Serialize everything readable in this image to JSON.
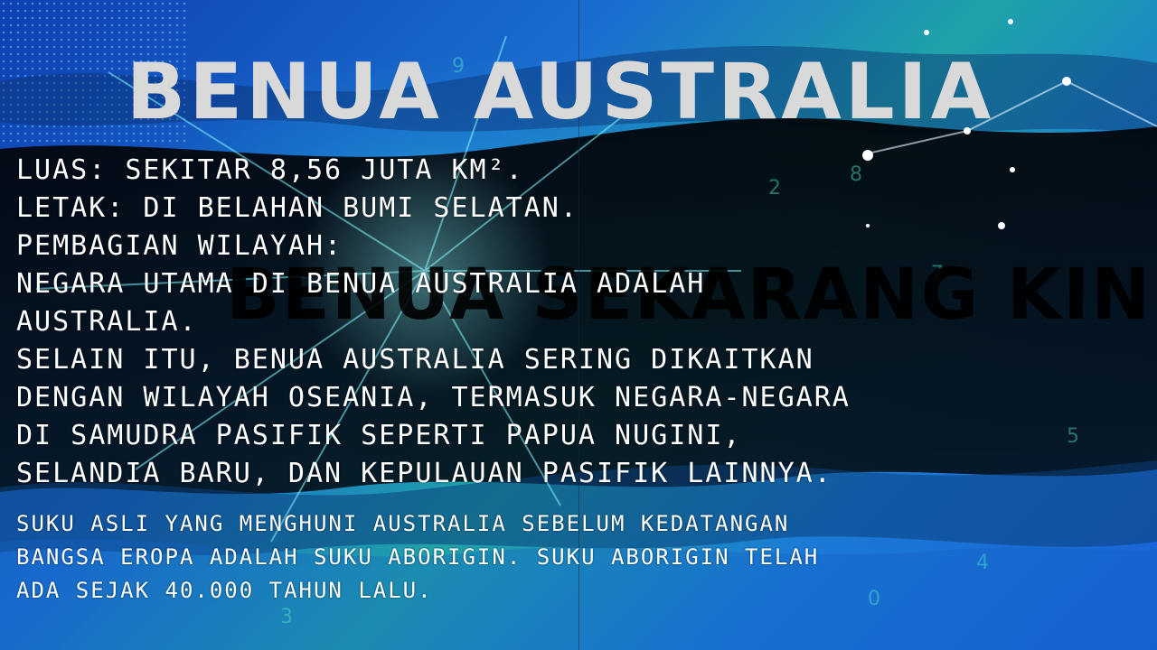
{
  "slide": {
    "title": "BENUA AUSTRALIA",
    "ghost_text": "BENUA SEKARANG KINI",
    "body_lines": [
      "LUAS: SEKITAR 8,56 JUTA KM².",
      "LETAK: DI BELAHAN BUMI SELATAN.",
      "PEMBAGIAN WILAYAH:",
      "NEGARA UTAMA DI BENUA AUSTRALIA ADALAH",
      "AUSTRALIA.",
      "SELAIN ITU, BENUA AUSTRALIA SERING DIKAITKAN",
      "DENGAN WILAYAH OSEANIA, TERMASUK NEGARA-NEGARA",
      "DI SAMUDRA PASIFIK SEPERTI PAPUA NUGINI,",
      "SELANDIA BARU, DAN KEPULAUAN PASIFIK LAINNYA."
    ],
    "note_lines": [
      "SUKU ASLI YANG MENGHUNI AUSTRALIA SEBELUM KEDATANGAN",
      "BANGSA EROPA ADALAH SUKU ABORIGIN. SUKU ABORIGIN TELAH",
      "ADA SEJAK 40.000 TAHUN LALU."
    ]
  },
  "colors": {
    "background_primary": "#1a5fd8",
    "background_teal": "#1fa3a8",
    "title_color": "#d9d9d9",
    "text_color": "#ffffff"
  }
}
